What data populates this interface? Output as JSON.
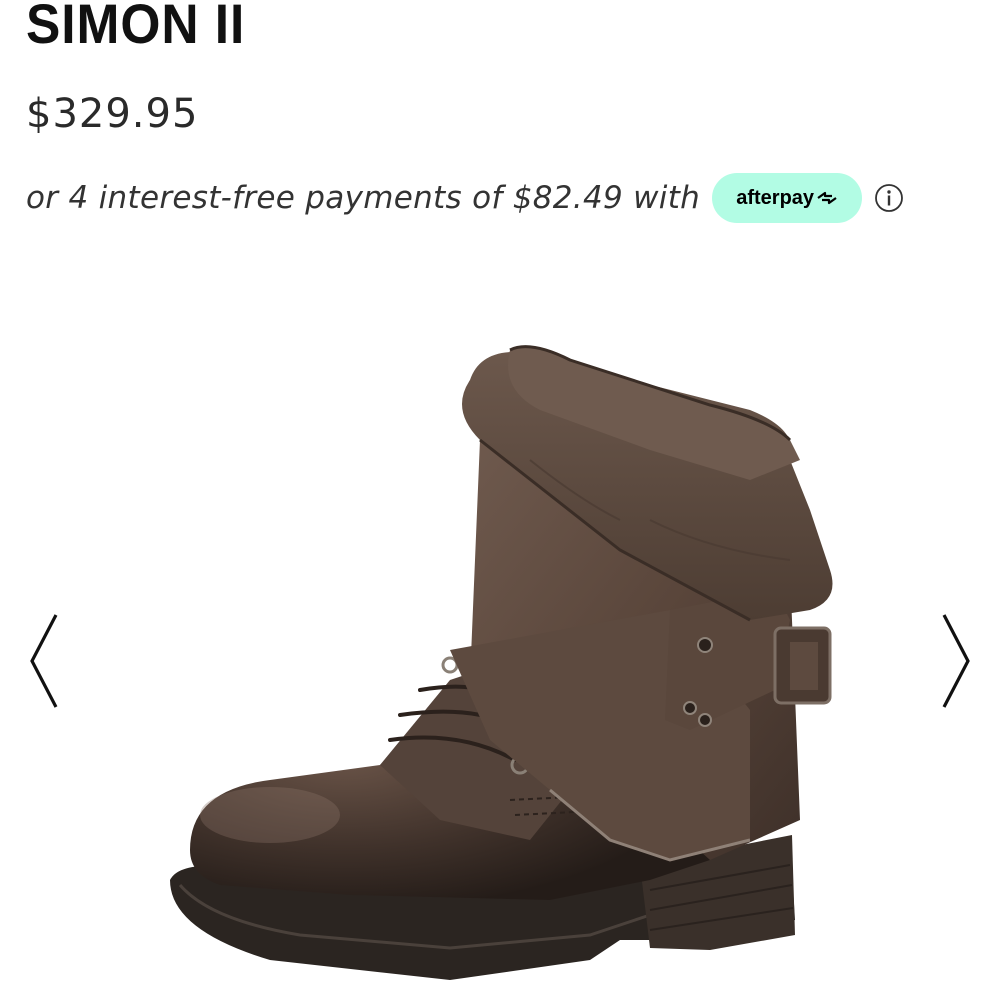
{
  "product": {
    "title": "SIMON II",
    "price": "$329.95"
  },
  "afterpay": {
    "text": "or 4 interest-free payments of $82.49 with",
    "badge_label": "afterpay",
    "badge_color": "#b2fce4",
    "info_icon": "info-circle-icon"
  },
  "gallery": {
    "image_subject": "brown leather fold-over ankle boot with buckle strap and laces",
    "prev_icon": "chevron-left-icon",
    "next_icon": "chevron-right-icon"
  },
  "colors": {
    "leather": "#5e4a3f",
    "leather_dark": "#3a2d26",
    "sole": "#2a2522"
  }
}
